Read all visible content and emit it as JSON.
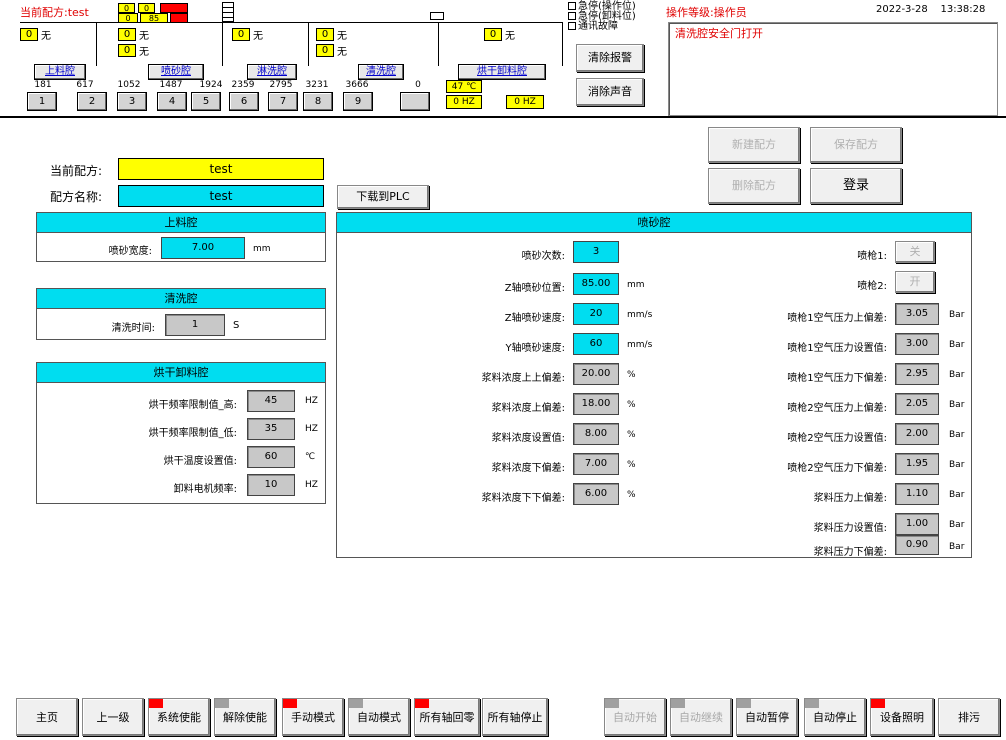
{
  "header": {
    "current_recipe_label": "当前配方:",
    "current_recipe_value": "test",
    "top_boxes": {
      "a": "0",
      "b": "0",
      "c": "0",
      "d": "0",
      "e": "0",
      "f": "85"
    },
    "load_status": {
      "value": "0",
      "text": "无"
    },
    "sand_status": [
      {
        "value": "0",
        "text": "无"
      },
      {
        "value": "0",
        "text": "无"
      }
    ],
    "rinse_status": {
      "value": "0",
      "text": "无"
    },
    "clean_status": [
      {
        "value": "0",
        "text": "无"
      },
      {
        "value": "0",
        "text": "无"
      }
    ],
    "dry_status": {
      "value": "0",
      "text": "无"
    },
    "stations": [
      "上料腔",
      "喷砂腔",
      "淋洗腔",
      "清洗腔",
      "烘干卸料腔"
    ],
    "positions": [
      "181",
      "617",
      "1052",
      "1487",
      "1924",
      "2359",
      "2795",
      "3231",
      "3666",
      "0"
    ],
    "slots": [
      "1",
      "2",
      "3",
      "4",
      "5",
      "6",
      "7",
      "8",
      "9",
      ""
    ],
    "temp": "47 ℃",
    "hz1": "0 HZ",
    "hz2": "0 HZ",
    "checks": [
      "急停(操作位)",
      "急停(卸料位)",
      "通讯故障"
    ],
    "clear_alarm": "清除报警",
    "clear_sound": "消除声音",
    "operator_level": "操作等级:操作员",
    "datetime": "2022-3-28    13:38:28",
    "alarm_message": "清洗腔安全门打开"
  },
  "recipe": {
    "current_label": "当前配方:",
    "current_value": "test",
    "name_label": "配方名称:",
    "name_value": "test",
    "download_btn": "下载到PLC",
    "new_btn": "新建配方",
    "save_btn": "保存配方",
    "delete_btn": "删除配方",
    "login_btn": "登录"
  },
  "loading": {
    "title": "上料腔",
    "width_label": "喷砂宽度:",
    "width_value": "7.00",
    "width_unit": "mm"
  },
  "cleaning": {
    "title": "清洗腔",
    "time_label": "清洗时间:",
    "time_value": "1",
    "time_unit": "S"
  },
  "drying": {
    "title": "烘干卸料腔",
    "rows": [
      {
        "label": "烘干频率限制值_高:",
        "value": "45",
        "unit": "HZ"
      },
      {
        "label": "烘干频率限制值_低:",
        "value": "35",
        "unit": "HZ"
      },
      {
        "label": "烘干温度设置值:",
        "value": "60",
        "unit": "℃"
      },
      {
        "label": "卸料电机频率:",
        "value": "10",
        "unit": "HZ"
      }
    ]
  },
  "sandblast": {
    "title": "喷砂腔",
    "left_rows": [
      {
        "label": "喷砂次数:",
        "value": "3",
        "unit": "",
        "style": "cyan"
      },
      {
        "label": "Z轴喷砂位置:",
        "value": "85.00",
        "unit": "mm",
        "style": "cyan"
      },
      {
        "label": "Z轴喷砂速度:",
        "value": "20",
        "unit": "mm/s",
        "style": "cyan"
      },
      {
        "label": "Y轴喷砂速度:",
        "value": "60",
        "unit": "mm/s",
        "style": "cyan"
      },
      {
        "label": "浆料浓度上上偏差:",
        "value": "20.00",
        "unit": "%",
        "style": "gray"
      },
      {
        "label": "浆料浓度上偏差:",
        "value": "18.00",
        "unit": "%",
        "style": "gray"
      },
      {
        "label": "浆料浓度设置值:",
        "value": "8.00",
        "unit": "%",
        "style": "gray"
      },
      {
        "label": "浆料浓度下偏差:",
        "value": "7.00",
        "unit": "%",
        "style": "gray"
      },
      {
        "label": "浆料浓度下下偏差:",
        "value": "6.00",
        "unit": "%",
        "style": "gray"
      }
    ],
    "gun1_label": "喷枪1:",
    "gun1_state": "关",
    "gun2_label": "喷枪2:",
    "gun2_state": "开",
    "right_rows": [
      {
        "label": "喷枪1空气压力上偏差:",
        "value": "3.05",
        "unit": "Bar"
      },
      {
        "label": "喷枪1空气压力设置值:",
        "value": "3.00",
        "unit": "Bar"
      },
      {
        "label": "喷枪1空气压力下偏差:",
        "value": "2.95",
        "unit": "Bar"
      },
      {
        "label": "喷枪2空气压力上偏差:",
        "value": "2.05",
        "unit": "Bar"
      },
      {
        "label": "喷枪2空气压力设置值:",
        "value": "2.00",
        "unit": "Bar"
      },
      {
        "label": "喷枪2空气压力下偏差:",
        "value": "1.95",
        "unit": "Bar"
      },
      {
        "label": "浆料压力上偏差:",
        "value": "1.10",
        "unit": "Bar"
      },
      {
        "label": "浆料压力设置值:",
        "value": "1.00",
        "unit": "Bar"
      },
      {
        "label": "浆料压力下偏差:",
        "value": "0.90",
        "unit": "Bar"
      }
    ]
  },
  "footer": {
    "buttons": [
      {
        "label": "主页",
        "ind": "",
        "enabled": true
      },
      {
        "label": "上一级",
        "ind": "",
        "enabled": true
      },
      {
        "label": "系统使能",
        "ind": "red",
        "enabled": true
      },
      {
        "label": "解除使能",
        "ind": "gray",
        "enabled": true
      },
      {
        "label": "手动模式",
        "ind": "red",
        "enabled": true
      },
      {
        "label": "自动模式",
        "ind": "gray",
        "enabled": true
      },
      {
        "label": "所有轴回零",
        "ind": "red",
        "enabled": true
      },
      {
        "label": "所有轴停止",
        "ind": "",
        "enabled": true
      },
      {
        "label": "自动开始",
        "ind": "gray",
        "enabled": false
      },
      {
        "label": "自动继续",
        "ind": "gray",
        "enabled": false
      },
      {
        "label": "自动暂停",
        "ind": "gray",
        "enabled": true
      },
      {
        "label": "自动停止",
        "ind": "gray",
        "enabled": true
      },
      {
        "label": "设备照明",
        "ind": "red",
        "enabled": true
      },
      {
        "label": "排污",
        "ind": "",
        "enabled": true
      }
    ]
  },
  "colors": {
    "accent": "#00ddf0",
    "yellow": "#ffff00",
    "alarm_red": "#e00000"
  }
}
